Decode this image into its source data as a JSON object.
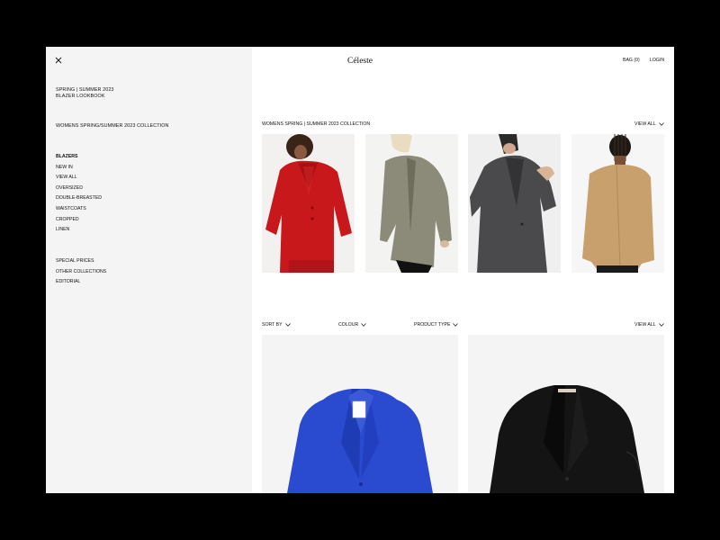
{
  "header": {
    "logo": "Céleste",
    "bag_label": "BAG (0)",
    "login_label": "LOGIN"
  },
  "sidebar": {
    "lookbook_line1": "SPRING | SUMMER 2023",
    "lookbook_line2": "BLAZER LOOKBOOK",
    "collection_link": "WOMENS SPRING/SUMMER 2023 COLLECTION",
    "categories": [
      "BLAZERS",
      "NEW IN",
      "VIEW ALL",
      "OVERSIZED",
      "DOUBLE-BREASTED",
      "WAISTCOATS",
      "CROPPED",
      "LINEN"
    ],
    "extra": [
      "SPECIAL PRICES",
      "OTHER COLLECTIONS",
      "EDITORIAL"
    ]
  },
  "collection": {
    "title": "WOMENS SPRING | SUMMER 2023 COLLECTION",
    "view_all": "VIEW ALL"
  },
  "filters": {
    "sort_by": "SORT BY",
    "colour": "COLOUR",
    "product_type": "PRODUCT TYPE",
    "view_all": "VIEW ALL"
  },
  "colors": {
    "red_blazer": "#c8181c",
    "olive_blazer": "#8c8a78",
    "grey_blazer": "#4a4a4c",
    "camel_blazer": "#c8a06e",
    "blue_blazer": "#2a4bd0",
    "black_blazer": "#141414"
  }
}
